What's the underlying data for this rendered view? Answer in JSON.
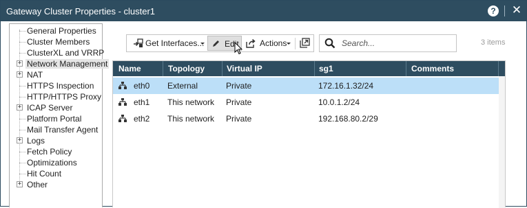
{
  "window": {
    "title": "Gateway Cluster Properties - cluster1",
    "help_label": "?",
    "close_label": "✕"
  },
  "nav": {
    "items": [
      {
        "label": "General Properties",
        "expandable": false,
        "selected": false
      },
      {
        "label": "Cluster Members",
        "expandable": false,
        "selected": false
      },
      {
        "label": "ClusterXL and VRRP",
        "expandable": false,
        "selected": false
      },
      {
        "label": "Network Management",
        "expandable": true,
        "selected": true
      },
      {
        "label": "NAT",
        "expandable": true,
        "selected": false
      },
      {
        "label": "HTTPS Inspection",
        "expandable": false,
        "selected": false
      },
      {
        "label": "HTTP/HTTPS Proxy",
        "expandable": false,
        "selected": false
      },
      {
        "label": "ICAP Server",
        "expandable": true,
        "selected": false
      },
      {
        "label": "Platform Portal",
        "expandable": false,
        "selected": false
      },
      {
        "label": "Mail Transfer Agent",
        "expandable": false,
        "selected": false
      },
      {
        "label": "Logs",
        "expandable": true,
        "selected": false
      },
      {
        "label": "Fetch Policy",
        "expandable": false,
        "selected": false
      },
      {
        "label": "Optimizations",
        "expandable": false,
        "selected": false
      },
      {
        "label": "Hit Count",
        "expandable": false,
        "selected": false
      },
      {
        "label": "Other",
        "expandable": true,
        "selected": false
      }
    ]
  },
  "toolbar": {
    "get_interfaces_label": "Get Interfaces...",
    "edit_label": "Edit",
    "actions_label": "Actions"
  },
  "search": {
    "placeholder": "Search..."
  },
  "items_count": "3 items",
  "table": {
    "columns": [
      "Name",
      "Topology",
      "Virtual IP",
      "sg1",
      "Comments"
    ],
    "rows": [
      {
        "name": "eth0",
        "topology": "External",
        "virtual_ip": "Private",
        "sg1": "172.16.1.32/24",
        "comments": "",
        "selected": true
      },
      {
        "name": "eth1",
        "topology": "This network",
        "virtual_ip": "Private",
        "sg1": "10.0.1.2/24",
        "comments": "",
        "selected": false
      },
      {
        "name": "eth2",
        "topology": "This network",
        "virtual_ip": "Private",
        "sg1": "192.168.80.2/29",
        "comments": "",
        "selected": false
      }
    ]
  },
  "colors": {
    "header_bg": "#2e4d60",
    "selected_row": "#bcdff8",
    "nav_selected": "#e5e5e5"
  }
}
